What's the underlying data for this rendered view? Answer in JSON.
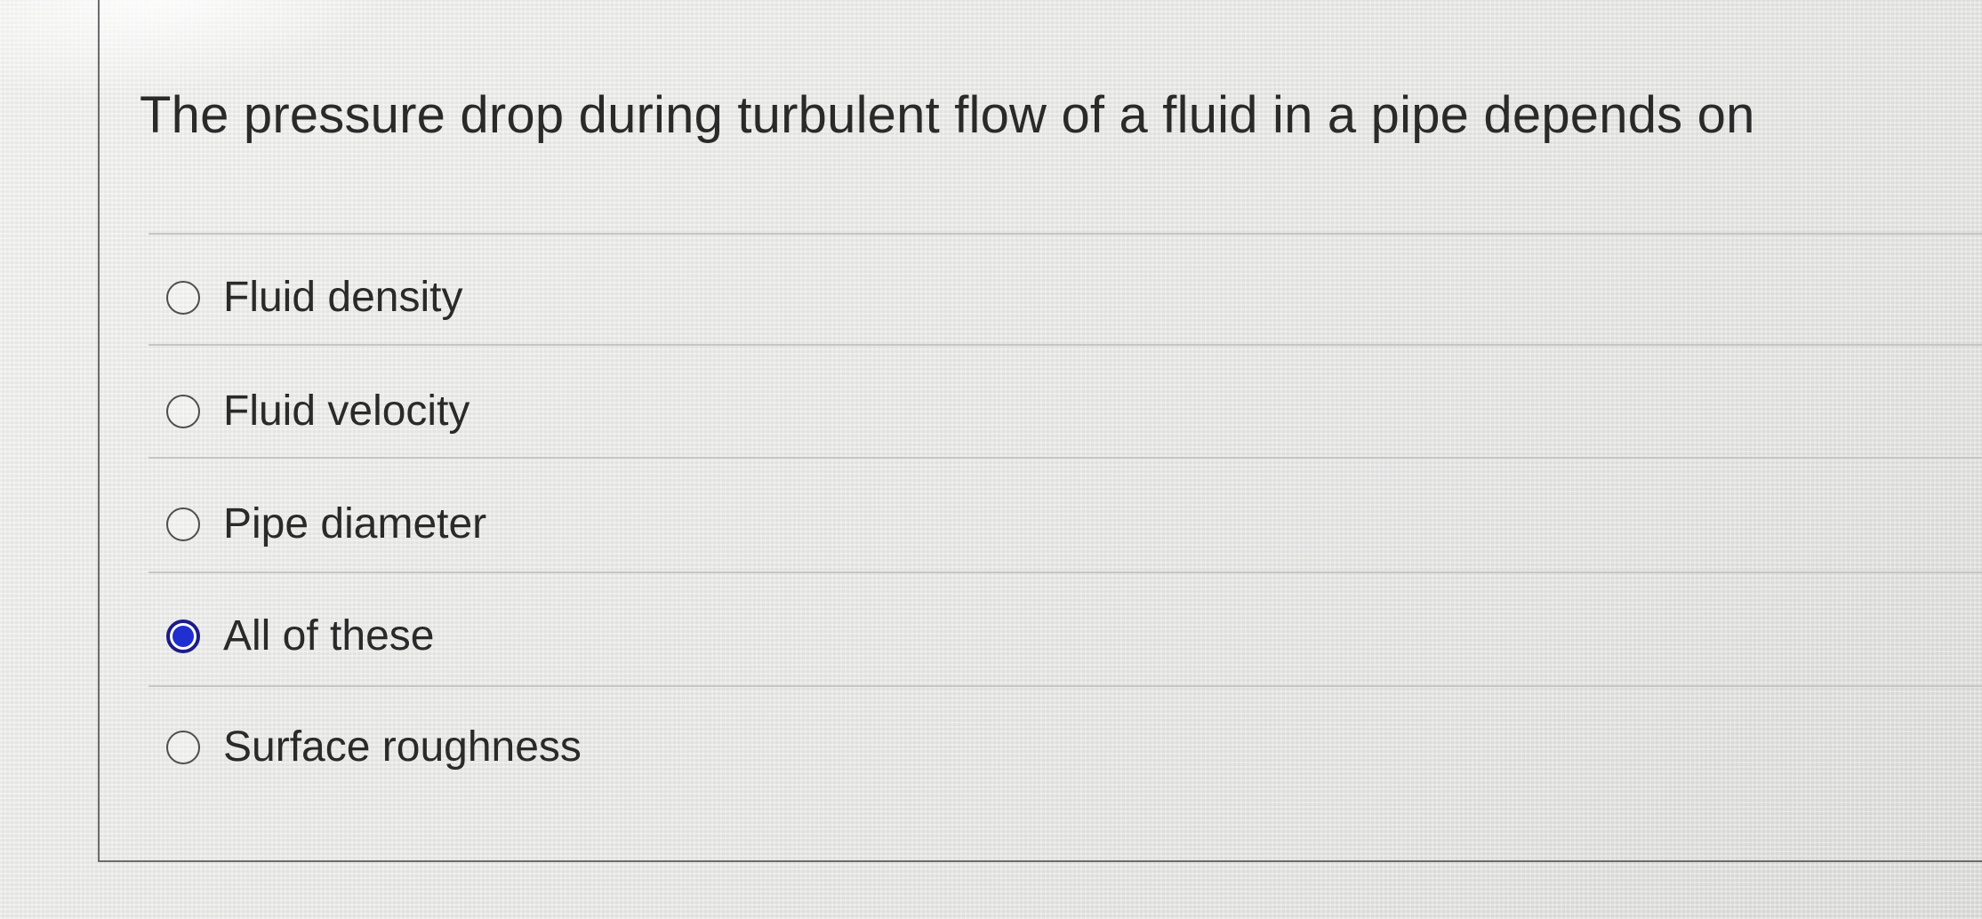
{
  "question": {
    "text": "The pressure drop during turbulent flow of a fluid in a pipe depends on"
  },
  "answers": [
    {
      "label": "Fluid density",
      "selected": false
    },
    {
      "label": "Fluid velocity",
      "selected": false
    },
    {
      "label": "Pipe diameter",
      "selected": false
    },
    {
      "label": "All of these",
      "selected": true
    },
    {
      "label": "Surface roughness",
      "selected": false
    }
  ],
  "colors": {
    "selected_radio_fill": "#1f2fd0",
    "selected_radio_border": "#1c1c86",
    "divider": "#c6c6c4",
    "text": "#2a2a2a"
  }
}
